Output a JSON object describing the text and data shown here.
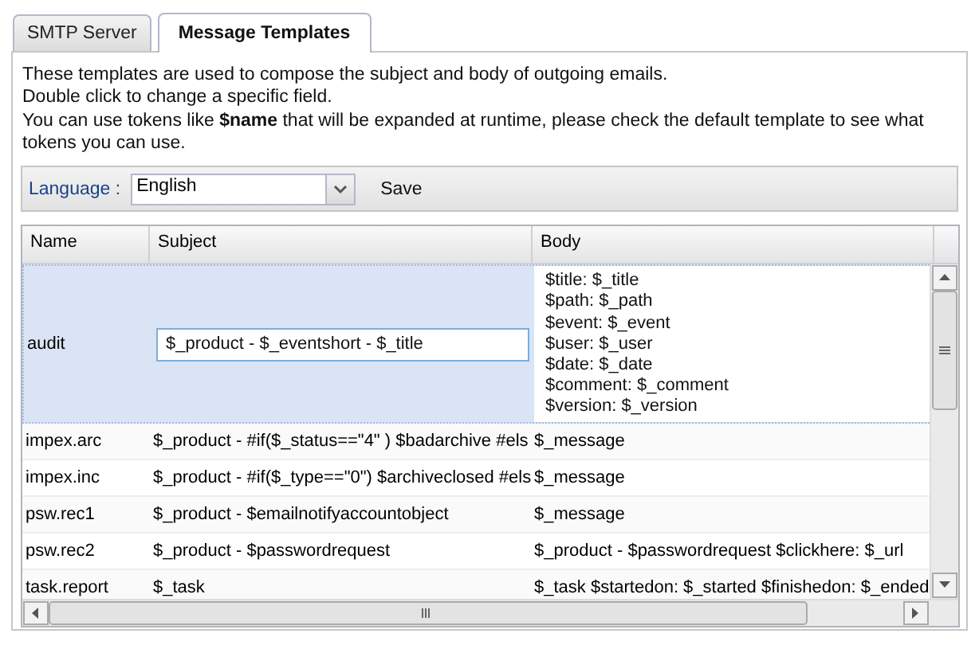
{
  "tabs": [
    {
      "label": "SMTP Server",
      "selected": false
    },
    {
      "label": "Message Templates",
      "selected": true
    }
  ],
  "description": [
    "These templates are used to compose the subject and body of outgoing emails.",
    "Double click to change a specific field.",
    "You can use tokens like **$name** that will be expanded at runtime, please check the default template to see what tokens you can use."
  ],
  "toolbar": {
    "language_label": "Language :",
    "language": "English",
    "save": "Save"
  },
  "table": {
    "columns": [
      "Name",
      "Subject",
      "Body"
    ],
    "rows": [
      {
        "name": "audit",
        "subject": "$_product - $_eventshort - $_title",
        "body": [
          "$title: $_title",
          "$path: $_path",
          "$event: $_event",
          "$user: $_user",
          "$date: $_date",
          "$comment: $_comment",
          "$version: $_version"
        ],
        "selected": true,
        "editing": true
      },
      {
        "name": "impex.arc",
        "subject": "$_product - #if($_status==\"4\" ) $badarchive #els",
        "body": [
          "$_message"
        ],
        "selected": false,
        "editing": false
      },
      {
        "name": "impex.inc",
        "subject": "$_product - #if($_type==\"0\") $archiveclosed #els",
        "body": [
          "$_message"
        ],
        "selected": false,
        "editing": false
      },
      {
        "name": "psw.rec1",
        "subject": "$_product - $emailnotifyaccountobject",
        "body": [
          "$_message"
        ],
        "selected": false,
        "editing": false
      },
      {
        "name": "psw.rec2",
        "subject": "$_product - $passwordrequest",
        "body": [
          "$_product - $passwordrequest $clickhere: $_url"
        ],
        "selected": false,
        "editing": false
      },
      {
        "name": "task.report",
        "subject": "$_task",
        "body": [
          "$_task $startedon: $_started $finishedon: $_ended"
        ],
        "selected": false,
        "editing": false
      }
    ]
  }
}
